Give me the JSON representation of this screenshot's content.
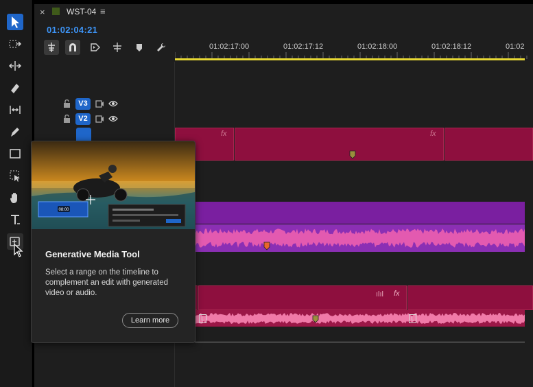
{
  "sequence": {
    "tab_name": "WST-04",
    "tab_close": "×",
    "tab_menu": "≡",
    "timecode": "01:02:04:21",
    "swatch_color": "#3f5a1a"
  },
  "ruler": {
    "labels": [
      "01:02:17:00",
      "01:02:17:12",
      "01:02:18:00",
      "01:02:18:12",
      "01:02"
    ]
  },
  "tracks": {
    "v3": "V3",
    "v2": "V2"
  },
  "clips": {
    "fx_label": "fx"
  },
  "tool_card": {
    "title": "Generative Media Tool",
    "description": "Select a range on the timeline to complement an edit with generated video or audio.",
    "learn_more": "Learn more",
    "preview_clip_time": "08:00"
  },
  "colors": {
    "accent_blue": "#1f66c9",
    "timecode_blue": "#3d94f6",
    "playhead_yellow": "#e6d733",
    "video_clip": "#8e0f3e",
    "audio_clip_purple": "#7a1fa0",
    "audio_wave_pink": "#e35ab0"
  }
}
